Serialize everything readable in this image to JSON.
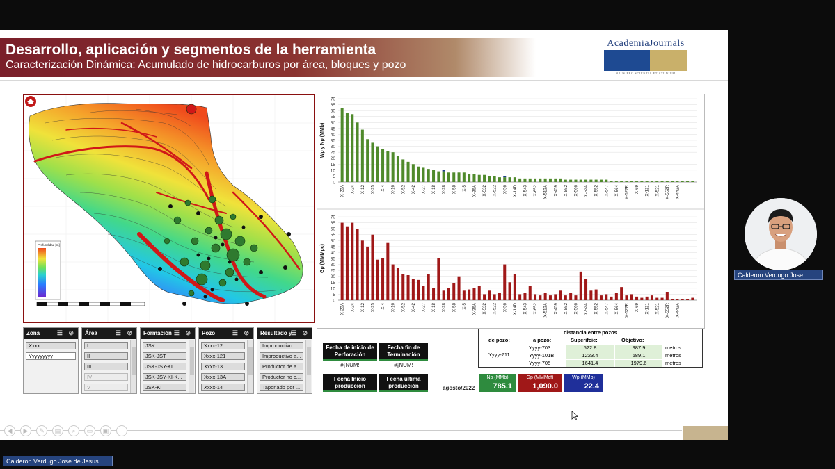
{
  "slide": {
    "title": "Desarrollo, aplicación y segmentos de la herramienta",
    "subtitle": "Caracterización Dinámica: Acumulado de hidrocarburos por área, bloques y pozo",
    "logo": {
      "name": "AcademiaJournals",
      "tagline": "OPUS PRO SCIENTIA ET STUDIUM"
    },
    "colors": {
      "header_band": "#7a1f2a",
      "logo_blue": "#1e4a92",
      "logo_gold": "#c9b06a"
    }
  },
  "map": {
    "legend_title": "Profundidad [m]",
    "home_icon": "home-icon"
  },
  "chart_data": [
    {
      "type": "bar",
      "ylabel": "Wp y Np (MMb)",
      "ylim": [
        0,
        70
      ],
      "yticks": [
        0,
        5,
        10,
        15,
        20,
        25,
        30,
        35,
        40,
        45,
        50,
        55,
        60,
        65,
        70
      ],
      "categories": [
        "X-23A",
        "X-24",
        "X-12",
        "X-25",
        "X-4",
        "X-16",
        "X-52",
        "X-42",
        "X-27",
        "X-18",
        "X-28",
        "X-58",
        "X-5",
        "X-36A",
        "X-532",
        "X-522",
        "X-56",
        "X-14D",
        "X-543",
        "X-652",
        "X-513A",
        "X-459",
        "X-852",
        "X-566",
        "X-52A",
        "X-552",
        "X-547",
        "X-564",
        "X-522R",
        "X-69",
        "X-121",
        "X-521",
        "X-552R",
        "X-442A"
      ],
      "series": [
        {
          "color": "#4f8a2b",
          "values": [
            62,
            58,
            57,
            50,
            44,
            36,
            33,
            30,
            28,
            26,
            25,
            22,
            19,
            17,
            15,
            13,
            12,
            11,
            10,
            9,
            9,
            8,
            8,
            8,
            8,
            7,
            7,
            6,
            6,
            5,
            5,
            4,
            4,
            4,
            4,
            3,
            3,
            3,
            3,
            3,
            3,
            3,
            3,
            3,
            2,
            2,
            2,
            2,
            2,
            2,
            2,
            2,
            2,
            1,
            1,
            1,
            1,
            1,
            1,
            1,
            1,
            1,
            1,
            1,
            1,
            1,
            1,
            1,
            1,
            1
          ]
        },
        {
          "color": "#1f3f8a",
          "values": [
            0,
            0,
            0,
            0,
            0,
            0,
            0,
            0,
            0,
            0,
            0,
            0,
            0,
            0,
            0,
            0,
            0,
            0,
            0,
            0,
            1,
            0,
            0,
            0,
            0,
            0,
            0,
            0,
            0,
            0,
            0,
            0,
            1,
            0,
            0,
            0,
            0,
            0,
            0,
            0,
            0,
            0,
            0,
            0,
            0,
            0,
            0,
            0,
            0,
            0,
            0,
            0,
            0,
            0,
            0,
            0,
            0,
            0,
            0,
            0,
            0,
            0,
            0,
            0,
            0,
            0,
            0,
            0,
            0,
            0
          ]
        }
      ]
    },
    {
      "type": "bar",
      "ylabel": "Gp (MMMpc)",
      "ylim": [
        0,
        70
      ],
      "yticks": [
        0,
        5,
        10,
        15,
        20,
        25,
        30,
        35,
        40,
        45,
        50,
        55,
        60,
        65,
        70
      ],
      "categories": [
        "X-23A",
        "X-24",
        "X-12",
        "X-25",
        "X-4",
        "X-16",
        "X-52",
        "X-42",
        "X-27",
        "X-18",
        "X-28",
        "X-58",
        "X-5",
        "X-36A",
        "X-532",
        "X-522",
        "X-56",
        "X-14D",
        "X-543",
        "X-652",
        "X-513A",
        "X-459",
        "X-852",
        "X-566",
        "X-52A",
        "X-552",
        "X-547",
        "X-564",
        "X-522R",
        "X-69",
        "X-121",
        "X-521",
        "X-552R",
        "X-442A"
      ],
      "series": [
        {
          "color": "#a01818",
          "values": [
            65,
            62,
            65,
            60,
            50,
            45,
            55,
            34,
            35,
            48,
            30,
            27,
            22,
            21,
            18,
            17,
            12,
            22,
            10,
            35,
            8,
            10,
            14,
            20,
            8,
            9,
            10,
            12,
            5,
            8,
            5,
            6,
            30,
            15,
            22,
            5,
            6,
            12,
            5,
            4,
            6,
            4,
            5,
            8,
            4,
            6,
            4,
            24,
            18,
            8,
            9,
            4,
            5,
            3,
            6,
            11,
            4,
            5,
            3,
            2,
            3,
            4,
            2,
            2,
            7,
            1,
            1,
            1,
            1,
            2
          ]
        }
      ]
    }
  ],
  "filters": [
    {
      "label": "Zona",
      "items": [
        "Xxxx",
        "Yyyyyyyyy"
      ]
    },
    {
      "label": "Área",
      "items": [
        "I",
        "II",
        "III",
        "IV",
        "V"
      ]
    },
    {
      "label": "Formación",
      "items": [
        "JSK",
        "JSK-JST",
        "JSK-JSY-KI",
        "JSK-JSY-KI-K...",
        "JSK-KI"
      ]
    },
    {
      "label": "Pozo",
      "items": [
        "Xxxx-12",
        "Xxxx-121",
        "Xxxx-13",
        "Xxxx-13A",
        "Xxxx-14"
      ]
    },
    {
      "label": "Resultado y...",
      "items": [
        "Improductivo ...",
        "Improductivo a...",
        "Productor de a...",
        "Productor no c...",
        "Taponado por ..."
      ]
    }
  ],
  "dates": {
    "perforacion_inicio": "Fecha de inicio de Perforación",
    "perforacion_fin": "Fecha fin de Terminación",
    "perforacion_inicio_val": "#¡NUM!",
    "perforacion_fin_val": "#¡NUM!",
    "produccion_inicio": "Fecha Inicio producción",
    "produccion_ultima": "Fecha última producción"
  },
  "distances": {
    "title": "distancia entre pozos",
    "col_de": "de pozo:",
    "col_a": "a pozo:",
    "col_sup": "Superifcie:",
    "col_obj": "Objetivo:",
    "from_well": "Yyyy-711",
    "unit": "metros",
    "rows": [
      {
        "to": "Yyyy-703",
        "sup": "522.8",
        "obj": "987.9"
      },
      {
        "to": "Yyyy-101B",
        "sup": "1223.4",
        "obj": "689.1"
      },
      {
        "to": "Yyyy-705",
        "sup": "1641.4",
        "obj": "1979.6"
      }
    ]
  },
  "kpis": {
    "date": "agosto/2022",
    "np": {
      "label": "Np (MMb)",
      "value": "785.1",
      "color": "#2e8b3e"
    },
    "gp": {
      "label": "Gp (MMMcf)",
      "value": "1,090.0",
      "color": "#a01818"
    },
    "wp": {
      "label": "Wp (MMb)",
      "value": "22.4",
      "color": "#1f2f9a"
    }
  },
  "participants": {
    "speaker": "Calderon Verdugo Jose ...",
    "self": "Calderon Verdugo Jose de Jesus"
  }
}
